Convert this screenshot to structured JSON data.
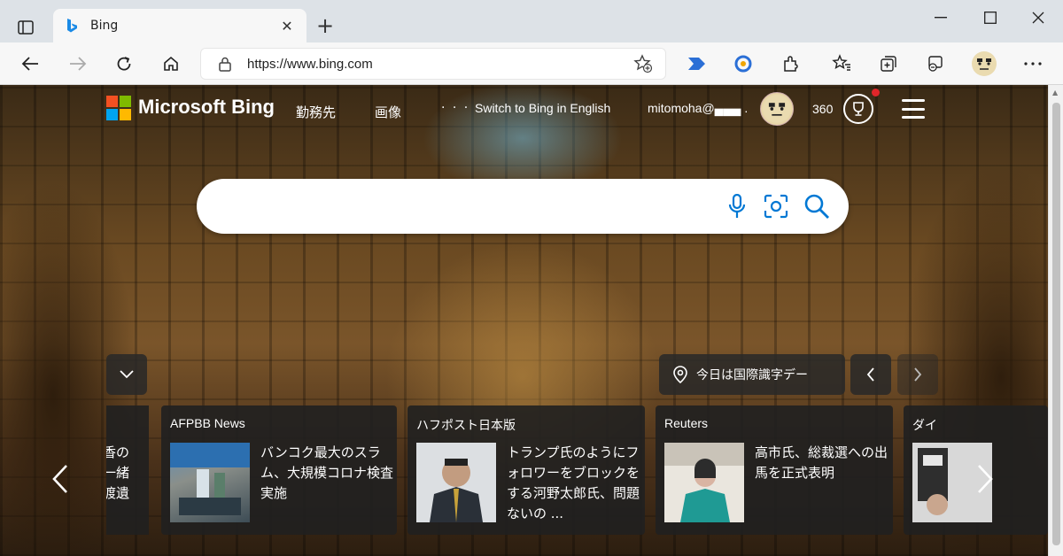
{
  "browser": {
    "tab_title": "Bing",
    "url": "https://www.bing.com"
  },
  "header": {
    "brand": "Microsoft Bing",
    "nav_items": [
      "勤務先",
      "画像"
    ],
    "more": "· · ·",
    "switch_language": "Switch to Bing in English",
    "user": "mitomoha@▄▄▄ .",
    "points": "360"
  },
  "search": {
    "placeholder": "",
    "value": ""
  },
  "today": {
    "label": "今日は国際識字デー"
  },
  "news": {
    "partial_left": "香の\n一緒\n渡遺\n.",
    "cards": [
      {
        "source": "AFPBB News",
        "headline": "バンコク最大のスラム、大規模コロナ検査実施"
      },
      {
        "source": "ハフポスト日本版",
        "headline": "トランプ氏のようにフォロワーをブロックをする河野太郎氏、問題ないの ..."
      },
      {
        "source": "Reuters",
        "headline": "高市氏、総裁選への出馬を正式表明"
      },
      {
        "source": "ダイ"
      }
    ]
  },
  "colors": {
    "accent": "#0078d4",
    "ms_red": "#f25022",
    "ms_green": "#7fba00",
    "ms_blue": "#00a4ef",
    "ms_yellow": "#ffb900"
  }
}
